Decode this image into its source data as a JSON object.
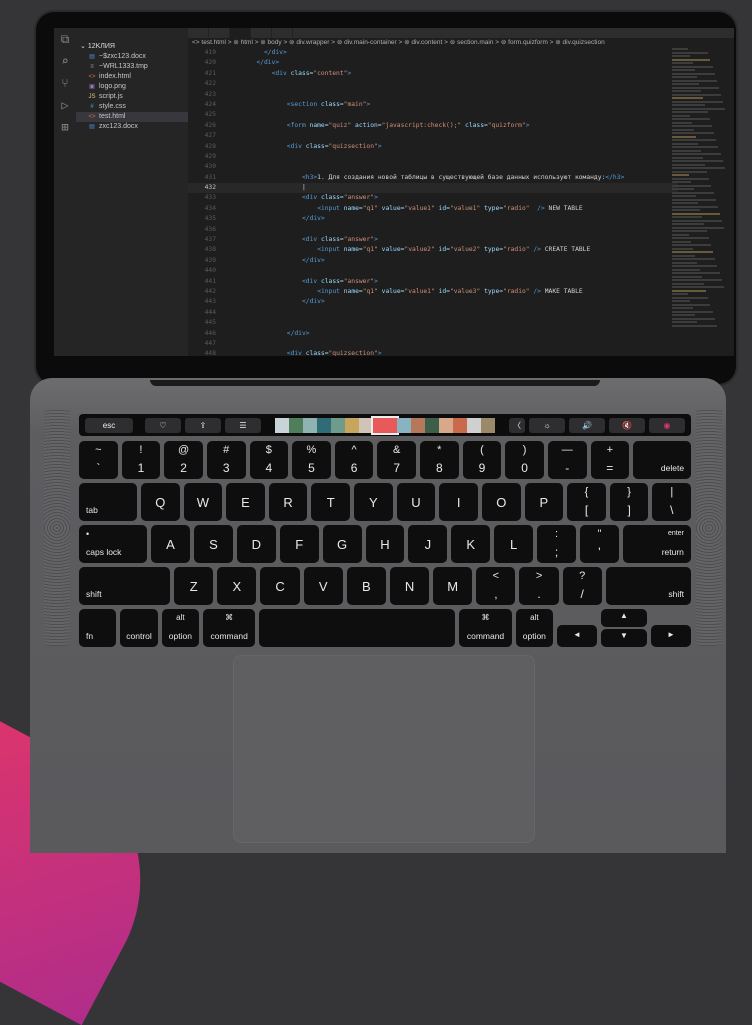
{
  "colors": {
    "background": "#353538",
    "accent": "#d8356f",
    "tag": "#569cd6",
    "attr": "#9cdcfe",
    "string": "#ce9178",
    "text": "#d4d4d4"
  },
  "explorer": {
    "folder": "12KЛИЯ",
    "files": [
      {
        "icon": "doc-icon",
        "glyph": "▤",
        "color": "#4f8bd6",
        "name": "~$zxc123.docx"
      },
      {
        "icon": "file-icon",
        "glyph": "≡",
        "color": "#9a9a9a",
        "name": "~WRL1333.tmp"
      },
      {
        "icon": "html-icon",
        "glyph": "<>",
        "color": "#e36c3a",
        "name": "index.html"
      },
      {
        "icon": "image-icon",
        "glyph": "▣",
        "color": "#a074c4",
        "name": "logo.png"
      },
      {
        "icon": "js-icon",
        "glyph": "JS",
        "color": "#e5c07b",
        "name": "script.js"
      },
      {
        "icon": "css-icon",
        "glyph": "#",
        "color": "#42a5f5",
        "name": "style.css"
      },
      {
        "icon": "html-icon",
        "glyph": "<>",
        "color": "#e36c3a",
        "name": "test.html",
        "selected": true
      },
      {
        "icon": "doc-icon",
        "glyph": "▤",
        "color": "#4f8bd6",
        "name": "zxc123.docx"
      }
    ]
  },
  "breadcrumb": "<> test.html > ⊚ html > ⊚ body > ⊚ div.wrapper > ⊚ div.main-container > ⊚ div.content > ⊚ section.main > ⊚ form.quizform > ⊚ div.quizsection",
  "code": [
    {
      "n": "419",
      "indent": 10,
      "parts": [
        [
          "t",
          "</div>"
        ]
      ]
    },
    {
      "n": "420",
      "indent": 8,
      "parts": [
        [
          "t",
          "</div>"
        ]
      ]
    },
    {
      "n": "421",
      "indent": 12,
      "parts": [
        [
          "t",
          "<div "
        ],
        [
          "a",
          "class="
        ],
        [
          "s",
          "\"content\""
        ],
        [
          "t",
          ">"
        ]
      ]
    },
    {
      "n": "422",
      "indent": 0,
      "parts": []
    },
    {
      "n": "423",
      "indent": 0,
      "parts": []
    },
    {
      "n": "424",
      "indent": 16,
      "parts": [
        [
          "t",
          "<section "
        ],
        [
          "a",
          "class="
        ],
        [
          "s",
          "\"main\""
        ],
        [
          "t",
          ">"
        ]
      ]
    },
    {
      "n": "425",
      "indent": 0,
      "parts": []
    },
    {
      "n": "426",
      "indent": 16,
      "parts": [
        [
          "t",
          "<form "
        ],
        [
          "a",
          "name="
        ],
        [
          "s",
          "\"quiz\""
        ],
        [
          "a",
          " action="
        ],
        [
          "s",
          "\"javascript:check();\""
        ],
        [
          "a",
          " class="
        ],
        [
          "s",
          "\"quizform\""
        ],
        [
          "t",
          ">"
        ]
      ]
    },
    {
      "n": "427",
      "indent": 0,
      "parts": []
    },
    {
      "n": "428",
      "indent": 16,
      "parts": [
        [
          "t",
          "<div "
        ],
        [
          "a",
          "class="
        ],
        [
          "s",
          "\"quizsection\""
        ],
        [
          "t",
          ">"
        ]
      ]
    },
    {
      "n": "429",
      "indent": 0,
      "parts": []
    },
    {
      "n": "430",
      "indent": 0,
      "parts": []
    },
    {
      "n": "431",
      "indent": 20,
      "parts": [
        [
          "t",
          "<h3>"
        ],
        [
          "p",
          "1. Для создания новой таблицы в существующей базе данных используют команду:"
        ],
        [
          "t",
          "</h3>"
        ]
      ]
    },
    {
      "n": "432",
      "indent": 20,
      "cur": true,
      "parts": [
        [
          "p",
          "|"
        ]
      ]
    },
    {
      "n": "433",
      "indent": 20,
      "parts": [
        [
          "t",
          "<div "
        ],
        [
          "a",
          "class="
        ],
        [
          "s",
          "\"answer\""
        ],
        [
          "t",
          ">"
        ]
      ]
    },
    {
      "n": "434",
      "indent": 24,
      "parts": [
        [
          "t",
          "<input "
        ],
        [
          "a",
          "name="
        ],
        [
          "s",
          "\"q1\""
        ],
        [
          "a",
          " value="
        ],
        [
          "s",
          "\"value1\""
        ],
        [
          "a",
          " id="
        ],
        [
          "s",
          "\"value1\""
        ],
        [
          "a",
          " type="
        ],
        [
          "s",
          "\"radio\""
        ],
        [
          "t",
          "  /> "
        ],
        [
          "p",
          "NEW TABLE"
        ]
      ]
    },
    {
      "n": "435",
      "indent": 20,
      "parts": [
        [
          "t",
          "</div>"
        ]
      ]
    },
    {
      "n": "436",
      "indent": 0,
      "parts": []
    },
    {
      "n": "437",
      "indent": 20,
      "parts": [
        [
          "t",
          "<div "
        ],
        [
          "a",
          "class="
        ],
        [
          "s",
          "\"answer\""
        ],
        [
          "t",
          ">"
        ]
      ]
    },
    {
      "n": "438",
      "indent": 24,
      "parts": [
        [
          "t",
          "<input "
        ],
        [
          "a",
          "name="
        ],
        [
          "s",
          "\"q1\""
        ],
        [
          "a",
          " value="
        ],
        [
          "s",
          "\"value2\""
        ],
        [
          "a",
          " id="
        ],
        [
          "s",
          "\"value2\""
        ],
        [
          "a",
          " type="
        ],
        [
          "s",
          "\"radio\""
        ],
        [
          "t",
          " /> "
        ],
        [
          "p",
          "CREATE TABLE"
        ]
      ]
    },
    {
      "n": "439",
      "indent": 20,
      "parts": [
        [
          "t",
          "</div>"
        ]
      ]
    },
    {
      "n": "440",
      "indent": 0,
      "parts": []
    },
    {
      "n": "441",
      "indent": 20,
      "parts": [
        [
          "t",
          "<div "
        ],
        [
          "a",
          "class="
        ],
        [
          "s",
          "\"answer\""
        ],
        [
          "t",
          ">"
        ]
      ]
    },
    {
      "n": "442",
      "indent": 24,
      "parts": [
        [
          "t",
          "<input "
        ],
        [
          "a",
          "name="
        ],
        [
          "s",
          "\"q1\""
        ],
        [
          "a",
          " value="
        ],
        [
          "s",
          "\"value1\""
        ],
        [
          "a",
          " id="
        ],
        [
          "s",
          "\"value3\""
        ],
        [
          "a",
          " type="
        ],
        [
          "s",
          "\"radio\""
        ],
        [
          "t",
          " /> "
        ],
        [
          "p",
          "MAKE TABLE"
        ]
      ]
    },
    {
      "n": "443",
      "indent": 20,
      "parts": [
        [
          "t",
          "</div>"
        ]
      ]
    },
    {
      "n": "444",
      "indent": 0,
      "parts": []
    },
    {
      "n": "445",
      "indent": 0,
      "parts": []
    },
    {
      "n": "446",
      "indent": 16,
      "parts": [
        [
          "t",
          "</div>"
        ]
      ]
    },
    {
      "n": "447",
      "indent": 0,
      "parts": []
    },
    {
      "n": "448",
      "indent": 16,
      "parts": [
        [
          "t",
          "<div "
        ],
        [
          "a",
          "class="
        ],
        [
          "s",
          "\"quizsection\""
        ],
        [
          "t",
          ">"
        ]
      ]
    }
  ],
  "touchbar": {
    "esc": "esc",
    "left_icons": [
      {
        "name": "favorite-heart-icon",
        "glyph": "♡"
      },
      {
        "name": "share-icon",
        "glyph": "⇪"
      },
      {
        "name": "adjust-sliders-icon",
        "glyph": "☰"
      }
    ],
    "photo_colors": [
      "#c9d4d8",
      "#4e7f5a",
      "#8fb3b0",
      "#2f6c77",
      "#6e9c8a",
      "#c7a55b",
      "#d0c4b8",
      "#e85a5a",
      "#8ab3c2",
      "#b5785a",
      "#3c5f4a",
      "#d8a88a",
      "#c96a4a",
      "#d0d0d0",
      "#9a8a6a"
    ],
    "right_icons": [
      {
        "name": "collapse-icon",
        "glyph": "〈"
      },
      {
        "name": "brightness-icon",
        "glyph": "☼"
      },
      {
        "name": "volume-icon",
        "glyph": "🔊"
      },
      {
        "name": "mute-icon",
        "glyph": "🔇"
      },
      {
        "name": "siri-icon",
        "glyph": "◉"
      }
    ]
  },
  "keyboard": {
    "row1": [
      [
        "~",
        "`"
      ],
      [
        "!",
        "1"
      ],
      [
        "@",
        "2"
      ],
      [
        "#",
        "3"
      ],
      [
        "$",
        "4"
      ],
      [
        "%",
        "5"
      ],
      [
        "^",
        "6"
      ],
      [
        "&",
        "7"
      ],
      [
        "*",
        "8"
      ],
      [
        "(",
        "9"
      ],
      [
        ")",
        "0"
      ],
      [
        "—",
        "-"
      ],
      [
        "+",
        "="
      ]
    ],
    "delete": "delete",
    "tab": "tab",
    "row2": [
      "Q",
      "W",
      "E",
      "R",
      "T",
      "Y",
      "U",
      "I",
      "O",
      "P"
    ],
    "row2_end": [
      [
        "{",
        "["
      ],
      [
        "}",
        "]"
      ],
      [
        "|",
        "\\"
      ]
    ],
    "caps": "caps lock",
    "caps_dot": "•",
    "row3": [
      "A",
      "S",
      "D",
      "F",
      "G",
      "H",
      "J",
      "K",
      "L"
    ],
    "row3_end": [
      [
        ":",
        ";"
      ],
      [
        "\"",
        "'"
      ]
    ],
    "enter": "enter",
    "return": "return",
    "shift": "shift",
    "row4": [
      "Z",
      "X",
      "C",
      "V",
      "B",
      "N",
      "M"
    ],
    "row4_end": [
      [
        "<",
        ","
      ],
      [
        ">",
        "."
      ],
      [
        "?",
        "/"
      ]
    ],
    "fn": "fn",
    "control": "control",
    "alt": "alt",
    "option": "option",
    "cmd_symbol": "⌘",
    "command": "command",
    "arrow_left": "◄",
    "arrow_up": "▲",
    "arrow_down": "▼",
    "arrow_right": "►"
  }
}
